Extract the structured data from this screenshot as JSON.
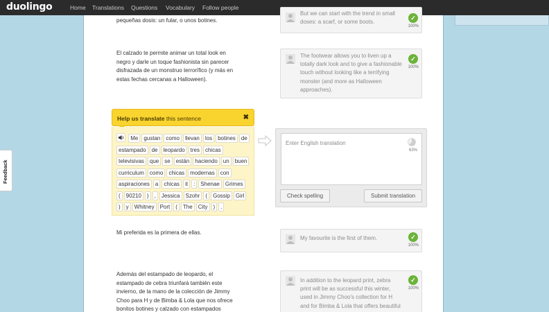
{
  "app": {
    "logo": "duolingo"
  },
  "nav": [
    "Home",
    "Translations",
    "Questions",
    "Vocabulary",
    "Follow people"
  ],
  "feedback_label": "Feedback",
  "sentences": [
    {
      "source_lines": [
        "pequeñas dosis: un fular, o unos botines."
      ],
      "translation": "But we can start with the trend in small doses: a scarf, or some boots.",
      "percent": "100%"
    },
    {
      "source_lines": [
        "El calzado te permite animar un total look en",
        "negro y darle un toque fashionista sin parecer",
        "disfrazada de un monstruo terrorífico (y más en",
        "estas fechas cercanas a Halloween)."
      ],
      "translation": "The footwear allows you to liven up a totally dark look and to give a fashionable touch without looking like a terrifying monster (and more as Halloween approaches).",
      "percent": "100%"
    },
    {
      "source_lines": [
        "Mi preferida es la primera de ellas."
      ],
      "translation": "My favourite is the first of them.",
      "percent": "100%"
    },
    {
      "source_lines": [
        "Además del estampado de leopardo, el",
        "estampado de cebra triunfará también este",
        "invierno, de la mano de la colección de Jimmy",
        "Choo para H y de Bimba & Lola que nos ofrece",
        "bonitos botines y calzado con estampados"
      ],
      "translation": "In addition to the leopard print, zebra print will be as successful this winter, used in Jimmy Choo's collection for H and for Bimba & Lola that offers beautiful boots and footwear with animal prints.",
      "percent": "100%"
    }
  ],
  "help": {
    "title_bold": "Help us translate",
    "title_rest": " this sentence",
    "close": "✖",
    "words": [
      "Me",
      "gustan",
      "como",
      "llevan",
      "los",
      "botines",
      "de",
      "estampado",
      "de",
      "leopardo",
      "tres",
      "chicas",
      "televisivas",
      "que",
      "se",
      "están",
      "haciendo",
      "un",
      "buen",
      "curriculum",
      "como",
      "chicas",
      "modernas",
      "con",
      "aspiraciones",
      "a",
      "chicas",
      "it",
      ":",
      "Shenae",
      "Grimes",
      "(",
      "90210",
      ")",
      ",",
      "Jessica",
      "Szohr",
      "(",
      "Gossip",
      "Girl",
      ")",
      "y",
      "Whitney",
      "Port",
      "(",
      "The",
      "City",
      ")",
      "."
    ]
  },
  "entry": {
    "placeholder": "Enter English translation",
    "percent": "63%",
    "progress": 0.63,
    "check_spelling": "Check spelling",
    "submit": "Submit translation"
  },
  "colors": {
    "accent_yellow": "#f9d42e",
    "check_green": "#6cb33a",
    "background": "#b4d7e6"
  }
}
